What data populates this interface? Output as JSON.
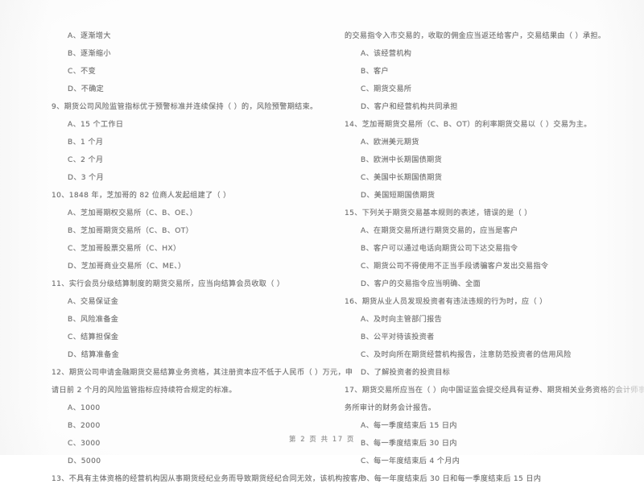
{
  "document": {
    "type": "scanned-exam-paper",
    "language": "zh-CN",
    "text_color": "#6f6f6f",
    "page_background": "#fdfdfd"
  },
  "left_column": {
    "lines": [
      {
        "kind": "opt",
        "text": "A、逐渐增大"
      },
      {
        "kind": "opt",
        "text": "B、逐渐缩小"
      },
      {
        "kind": "opt",
        "text": "C、不变"
      },
      {
        "kind": "opt",
        "text": "D、不确定"
      },
      {
        "kind": "q",
        "text": "9、期货公司风险监管指标优于预警标准并连续保持（     ）的，风险预警期结束。"
      },
      {
        "kind": "opt",
        "text": "A、15 个工作日"
      },
      {
        "kind": "opt",
        "text": "B、1 个月"
      },
      {
        "kind": "opt",
        "text": "C、2 个月"
      },
      {
        "kind": "opt",
        "text": "D、3 个月"
      },
      {
        "kind": "q",
        "text": "10、1848 年，芝加哥的 82 位商人发起组建了（     ）"
      },
      {
        "kind": "opt",
        "text": "A、芝加哥期权交易所（C、B、OE、）"
      },
      {
        "kind": "opt",
        "text": "B、芝加哥期货交易所（C、B、OT）"
      },
      {
        "kind": "opt",
        "text": "C、芝加哥股票交易所（C、HX）"
      },
      {
        "kind": "opt",
        "text": "D、芝加哥商业交易所（C、ME、）"
      },
      {
        "kind": "q",
        "text": "11、实行会员分级结算制度的期货交易所，应当向结算会员收取（     ）"
      },
      {
        "kind": "opt",
        "text": "A、交易保证金"
      },
      {
        "kind": "opt",
        "text": "B、风险准备金"
      },
      {
        "kind": "opt",
        "text": "C、结算担保金"
      },
      {
        "kind": "opt",
        "text": "D、结算准备金"
      },
      {
        "kind": "q",
        "text": "12、期货公司申请金融期货交易结算业务资格，其注册资本应不低于人民币（     ）万元，申"
      },
      {
        "kind": "qcont",
        "text": "请日前 2 个月的风险监管指标应持续符合规定的标准。"
      },
      {
        "kind": "opt",
        "text": "A、1000"
      },
      {
        "kind": "opt",
        "text": "B、2000"
      },
      {
        "kind": "opt",
        "text": "C、3000"
      },
      {
        "kind": "opt",
        "text": "D、5000"
      },
      {
        "kind": "q",
        "text": "13、不具有主体资格的经营机构因从事期货经纪业务而导致期货经纪合同无效，该机构按客户"
      }
    ]
  },
  "right_column": {
    "lines": [
      {
        "kind": "qcont",
        "text": "的交易指令入市交易的，收取的佣金应当返还给客户，交易结果由（     ）承担。"
      },
      {
        "kind": "opt",
        "text": "A、该经营机构"
      },
      {
        "kind": "opt",
        "text": "B、客户"
      },
      {
        "kind": "opt",
        "text": "C、期货交易所"
      },
      {
        "kind": "opt",
        "text": "D、客户和经营机构共同承担"
      },
      {
        "kind": "q",
        "text": "14、芝加哥期货交易所（C、B、OT）的利率期货交易以（     ）交易为主。"
      },
      {
        "kind": "opt",
        "text": "A、欧洲美元期货"
      },
      {
        "kind": "opt",
        "text": "B、欧洲中长期国债期货"
      },
      {
        "kind": "opt",
        "text": "C、美国中长期国债期货"
      },
      {
        "kind": "opt",
        "text": "D、美国短期国债期货"
      },
      {
        "kind": "q",
        "text": "15、下列关于期货交易基本规则的表述，错误的是（     ）"
      },
      {
        "kind": "opt",
        "text": "A、在期货交易所进行期货交易的，应当是客户"
      },
      {
        "kind": "opt",
        "text": "B、客户可以通过电话向期货公司下达交易指令"
      },
      {
        "kind": "opt",
        "text": "C、期货公司不得使用不正当手段诱骗客户发出交易指令"
      },
      {
        "kind": "opt",
        "text": "D、客户的交易指令应当明确、全面"
      },
      {
        "kind": "q",
        "text": "16、期货从业人员发现投资者有违法违规的行为时，应（     ）"
      },
      {
        "kind": "opt",
        "text": "A、及时向主管部门报告"
      },
      {
        "kind": "opt",
        "text": "B、公平对待该投资者"
      },
      {
        "kind": "opt",
        "text": "C、及时向所在期货经营机构报告，注意防范投资者的信用风险"
      },
      {
        "kind": "opt",
        "text": "D、了解投资者的投资目标"
      },
      {
        "kind": "q",
        "text": "17、期货交易所应当在（     ）向中国证监会提交经具有证券、期货相关业务资格的会计师事"
      },
      {
        "kind": "qcont",
        "text": "务所审计的财务会计报告。"
      },
      {
        "kind": "opt",
        "text": "A、每一季度结束后 15 日内"
      },
      {
        "kind": "opt",
        "text": "B、每一季度结束后 30 日内"
      },
      {
        "kind": "opt",
        "text": "C、每一年度结束后 4 个月内"
      },
      {
        "kind": "opt",
        "text": "D、每一年度结束后 30 日和每一季度结束后 15 日内"
      }
    ]
  },
  "footer": {
    "page_label": "第 2 页  共 17 页",
    "current_page": 2,
    "total_pages": 17
  }
}
